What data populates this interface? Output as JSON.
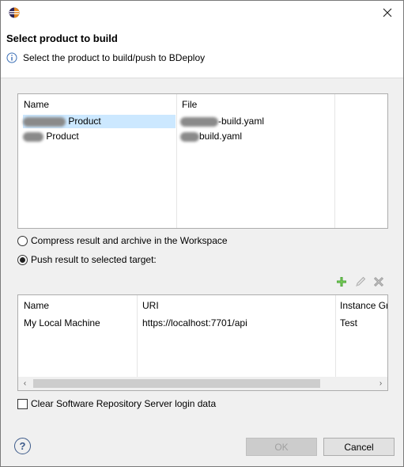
{
  "dialog": {
    "title": "Select product to build",
    "message": "Select the product to build/push to BDeploy"
  },
  "products_table": {
    "columns": [
      "Name",
      "File"
    ],
    "rows": [
      {
        "name": "Product",
        "file": "-build.yaml",
        "selected": true
      },
      {
        "name": "Product",
        "file": "build.yaml",
        "selected": false
      }
    ]
  },
  "options": {
    "compress_label": "Compress result and archive in the Workspace",
    "push_label": "Push result to selected target:",
    "selected": "push"
  },
  "targets_table": {
    "columns": [
      "Name",
      "URI",
      "Instance Gr"
    ],
    "rows": [
      {
        "name": "My Local Machine",
        "uri": "https://localhost:7701/api",
        "instance_group": "Test"
      }
    ]
  },
  "clear_login_label": "Clear Software Repository Server login data",
  "buttons": {
    "help": "?",
    "ok": "OK",
    "cancel": "Cancel"
  },
  "icons": {
    "app": "eclipse-icon",
    "close": "close-icon",
    "info": "info-icon",
    "add": "add-icon",
    "edit": "edit-icon",
    "delete": "delete-icon"
  }
}
